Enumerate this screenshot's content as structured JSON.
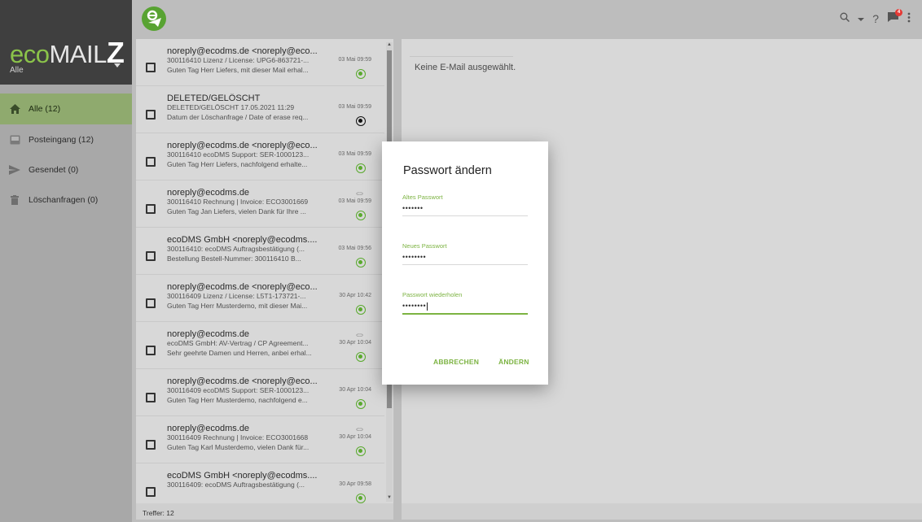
{
  "app": {
    "brand_eco": "eco",
    "brand_mail": "MAIL",
    "brand_z": "Z",
    "filter_label": "Alle"
  },
  "sidebar": {
    "items": [
      {
        "label": "Alle (12)",
        "icon": "home-icon",
        "active": true
      },
      {
        "label": "Posteingang (12)",
        "icon": "inbox-icon",
        "active": false
      },
      {
        "label": "Gesendet (0)",
        "icon": "send-icon",
        "active": false
      },
      {
        "label": "Löschanfragen (0)",
        "icon": "trash-icon",
        "active": false
      }
    ]
  },
  "topbar": {
    "help_label": "?",
    "notification_count": "4"
  },
  "mails": [
    {
      "from": "noreply@ecodms.de <noreply@eco...",
      "subject": "300116410 Lizenz / License: UPG6-863721-...",
      "preview": "Guten Tag Herr Liefers, mit dieser Mail erhal...",
      "date": "03 Mai 09:59",
      "status": "green",
      "attachment": false
    },
    {
      "from": "DELETED/GELÖSCHT",
      "subject": "DELETED/GELÖSCHT 17.05.2021 11:29",
      "preview": "Datum der Löschanfrage / Date of erase req...",
      "date": "03 Mai 09:59",
      "status": "black",
      "attachment": false
    },
    {
      "from": "noreply@ecodms.de <noreply@eco...",
      "subject": "300116410 ecoDMS Support: SER-1000123...",
      "preview": "Guten Tag Herr Liefers, nachfolgend erhalte...",
      "date": "03 Mai 09:59",
      "status": "green",
      "attachment": false
    },
    {
      "from": "noreply@ecodms.de",
      "subject": "300116410 Rechnung | Invoice: ECO3001669",
      "preview": "Guten Tag Jan Liefers, vielen Dank für Ihre ...",
      "date": "03 Mai 09:59",
      "status": "green",
      "attachment": true
    },
    {
      "from": "ecoDMS GmbH <noreply@ecodms....",
      "subject": "300116410: ecoDMS Auftragsbestätigung (...",
      "preview": "Bestellung  Bestell-Nummer: 300116410 B...",
      "date": "03 Mai 09:56",
      "status": "green",
      "attachment": false
    },
    {
      "from": "noreply@ecodms.de <noreply@eco...",
      "subject": "300116409 Lizenz / License: L5T1-173721-...",
      "preview": "Guten Tag Herr Musterdemo, mit dieser Mai...",
      "date": "30 Apr 10:42",
      "status": "green",
      "attachment": false
    },
    {
      "from": "noreply@ecodms.de",
      "subject": "ecoDMS GmbH: AV-Vertrag / CP Agreement...",
      "preview": "Sehr geehrte Damen und Herren, anbei erhal...",
      "date": "30 Apr 10:04",
      "status": "green",
      "attachment": true
    },
    {
      "from": "noreply@ecodms.de <noreply@eco...",
      "subject": "300116409 ecoDMS Support: SER-1000123...",
      "preview": "Guten Tag Herr Musterdemo, nachfolgend e...",
      "date": "30 Apr 10:04",
      "status": "green",
      "attachment": false
    },
    {
      "from": "noreply@ecodms.de",
      "subject": "300116409 Rechnung | Invoice: ECO3001668",
      "preview": "Guten Tag Karl Musterdemo, vielen Dank für...",
      "date": "30 Apr 10:04",
      "status": "green",
      "attachment": true
    },
    {
      "from": "ecoDMS GmbH <noreply@ecodms....",
      "subject": "300116409: ecoDMS Auftragsbestätigung (...",
      "preview": "",
      "date": "30 Apr 09:58",
      "status": "green",
      "attachment": false
    }
  ],
  "list_footer": "Treffer: 12",
  "preview": {
    "empty_text": "Keine E-Mail ausgewählt."
  },
  "dialog": {
    "title": "Passwort ändern",
    "fields": [
      {
        "label": "Altes Passwort",
        "value": "•••••••"
      },
      {
        "label": "Neues Passwort",
        "value": "••••••••"
      },
      {
        "label": "Passwort wiederholen",
        "value": "••••••••"
      }
    ],
    "cancel_label": "ABBRECHEN",
    "confirm_label": "ÄNDERN"
  },
  "colors": {
    "accent": "#7cb342",
    "status_green": "#5aaa2e",
    "sidebar_active": "#8faa6e"
  }
}
